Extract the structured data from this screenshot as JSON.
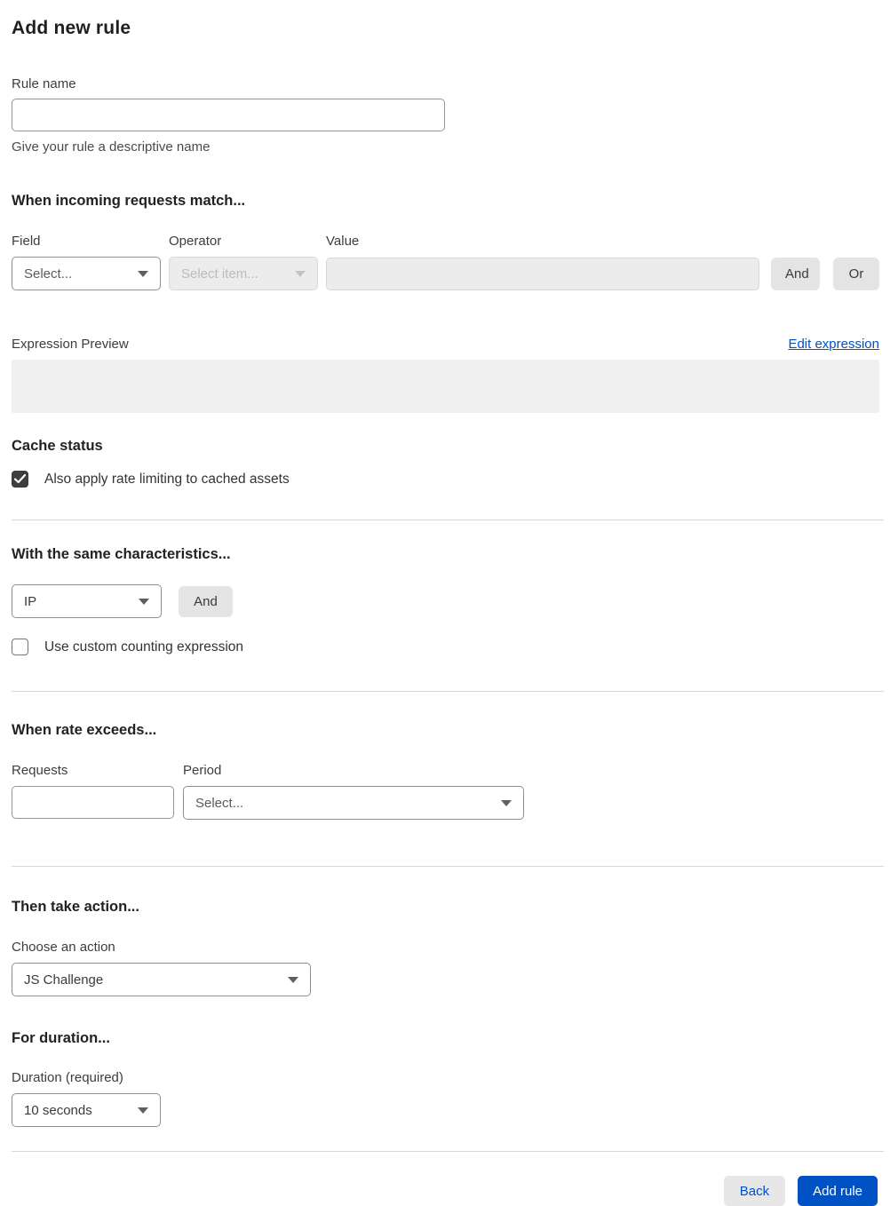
{
  "page": {
    "title": "Add new rule"
  },
  "rule_name": {
    "label": "Rule name",
    "value": "",
    "helper": "Give your rule a descriptive name"
  },
  "match": {
    "heading": "When incoming requests match...",
    "field": {
      "label": "Field",
      "placeholder": "Select..."
    },
    "operator": {
      "label": "Operator",
      "placeholder": "Select item..."
    },
    "value": {
      "label": "Value",
      "value": ""
    },
    "and_label": "And",
    "or_label": "Or"
  },
  "expression": {
    "label": "Expression Preview",
    "edit_link": "Edit expression",
    "content": ""
  },
  "cache": {
    "heading": "Cache status",
    "checkbox_label": "Also apply rate limiting to cached assets",
    "checked": true
  },
  "characteristics": {
    "heading": "With the same characteristics...",
    "selected": "IP",
    "and_label": "And",
    "checkbox_label": "Use custom counting expression",
    "checked": false
  },
  "rate": {
    "heading": "When rate exceeds...",
    "requests_label": "Requests",
    "requests_value": "",
    "period_label": "Period",
    "period_placeholder": "Select..."
  },
  "action": {
    "heading": "Then take action...",
    "label": "Choose an action",
    "selected": "JS Challenge"
  },
  "duration": {
    "heading": "For duration...",
    "label": "Duration (required)",
    "selected": "10 seconds"
  },
  "footer": {
    "back_label": "Back",
    "submit_label": "Add rule"
  },
  "colors": {
    "accent_blue": "#0051c3",
    "checkbox_checked": "#3d3d3d",
    "disabled_bg": "#ececec",
    "preview_bg": "#f0f0f0"
  }
}
